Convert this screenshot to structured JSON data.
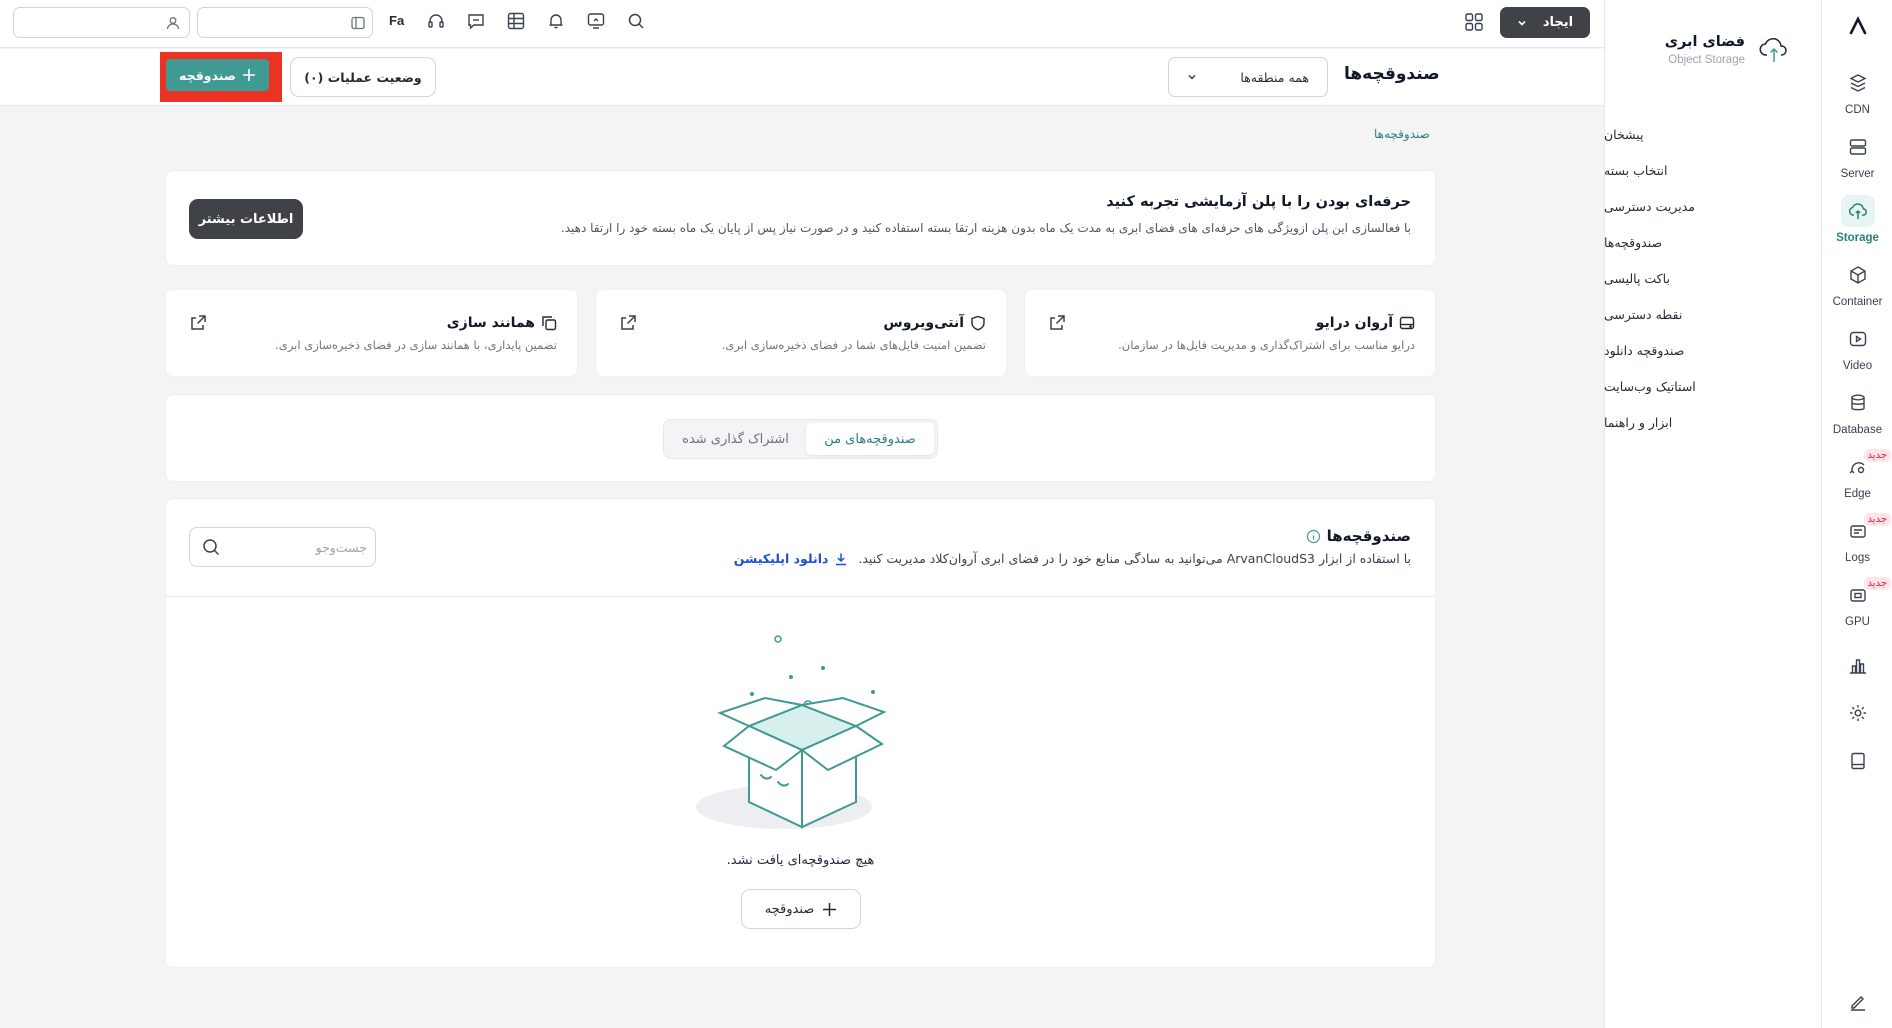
{
  "topbar": {
    "create_label": "ایجاد",
    "language": "Fa",
    "icons": [
      "apps-grid-icon",
      "search-icon",
      "monitor-icon",
      "bell-icon",
      "table-icon",
      "chat-icon",
      "headset-icon",
      "panel-icon",
      "user-icon"
    ]
  },
  "rail": {
    "items": [
      {
        "label": "CDN",
        "icon": "cdn-icon"
      },
      {
        "label": "Server",
        "icon": "server-icon"
      },
      {
        "label": "Storage",
        "icon": "cloud-upload-icon",
        "active": true
      },
      {
        "label": "Container",
        "icon": "cube-icon"
      },
      {
        "label": "Video",
        "icon": "video-icon"
      },
      {
        "label": "Database",
        "icon": "database-icon"
      },
      {
        "label": "Edge",
        "icon": "edge-icon",
        "badge": "جدید"
      },
      {
        "label": "Logs",
        "icon": "logs-icon",
        "badge": "جدید"
      },
      {
        "label": "GPU",
        "icon": "gpu-icon",
        "badge": "جدید"
      }
    ],
    "bottom_icons": [
      "chart-icon",
      "gear-icon",
      "book-icon",
      "edit-icon"
    ]
  },
  "sidebar": {
    "title": "فضای ابری",
    "subtitle": "Object Storage",
    "items": [
      "پیشخان",
      "انتخاب بسته",
      "مدیریت دسترسی",
      "صندوقچه‌ها",
      "باکت پالیسی",
      "نقطه دسترسی",
      "صندوقچه دانلود",
      "استاتیک وب‌سایت",
      "ابزار و راهنما"
    ]
  },
  "header": {
    "title": "صندوقچه‌ها",
    "region_select": "همه منطقه‌ها",
    "ops_status": "وضعیت عملیات (۰)",
    "add_button": "صندوقچه"
  },
  "breadcrumb": "صندوقچه‌ها",
  "promo": {
    "title": "حرفه‌ای بودن را با پلن آزمایشی تجربه کنید",
    "description": "با فعالسازی این پلن ازویژگی های حرفه‌ای های فضای ابری به مدت یک ماه بدون هزینه ارتقا بسته استفاده کنید و در صورت نیاز پس از پایان یک ماه بسته خود را ارتقا دهید.",
    "button": "اطلاعات بیشتر"
  },
  "features": [
    {
      "title": "آروان درایو",
      "description": "درایو مناسب برای اشتراک‌گذاری و مدیریت فایل‌ها در سازمان.",
      "icon": "drive-icon"
    },
    {
      "title": "آنتی‌ویروس",
      "description": "تضمین امنیت فایل‌های شما در فضای ذخیره‌سازی ابری.",
      "icon": "shield-icon"
    },
    {
      "title": "همانند سازی",
      "description": "تضمین پایداری، با همانند سازی در فضای ذخیره‌سازی ابری.",
      "icon": "copy-icon"
    }
  ],
  "tabs": {
    "mine": "صندوقچه‌های من",
    "shared": "اشتراک گذاری شده"
  },
  "list": {
    "title": "صندوقچه‌ها",
    "description": "با استفاده از ابزار ArvanCloudS3 می‌توانید به سادگی منابع خود را در فضای ابری آروان‌کلاد مدیریت کنید.",
    "download_link": "دانلود اپلیکیشن",
    "search_placeholder": "جست‌وجو",
    "empty_text": "هیچ صندوقچه‌ای یافت نشد.",
    "empty_button": "صندوقچه"
  },
  "colors": {
    "accent": "#3f9a93",
    "dark_button": "#3f4347",
    "highlight_frame": "#ea3323",
    "new_badge": "#e11d48"
  }
}
